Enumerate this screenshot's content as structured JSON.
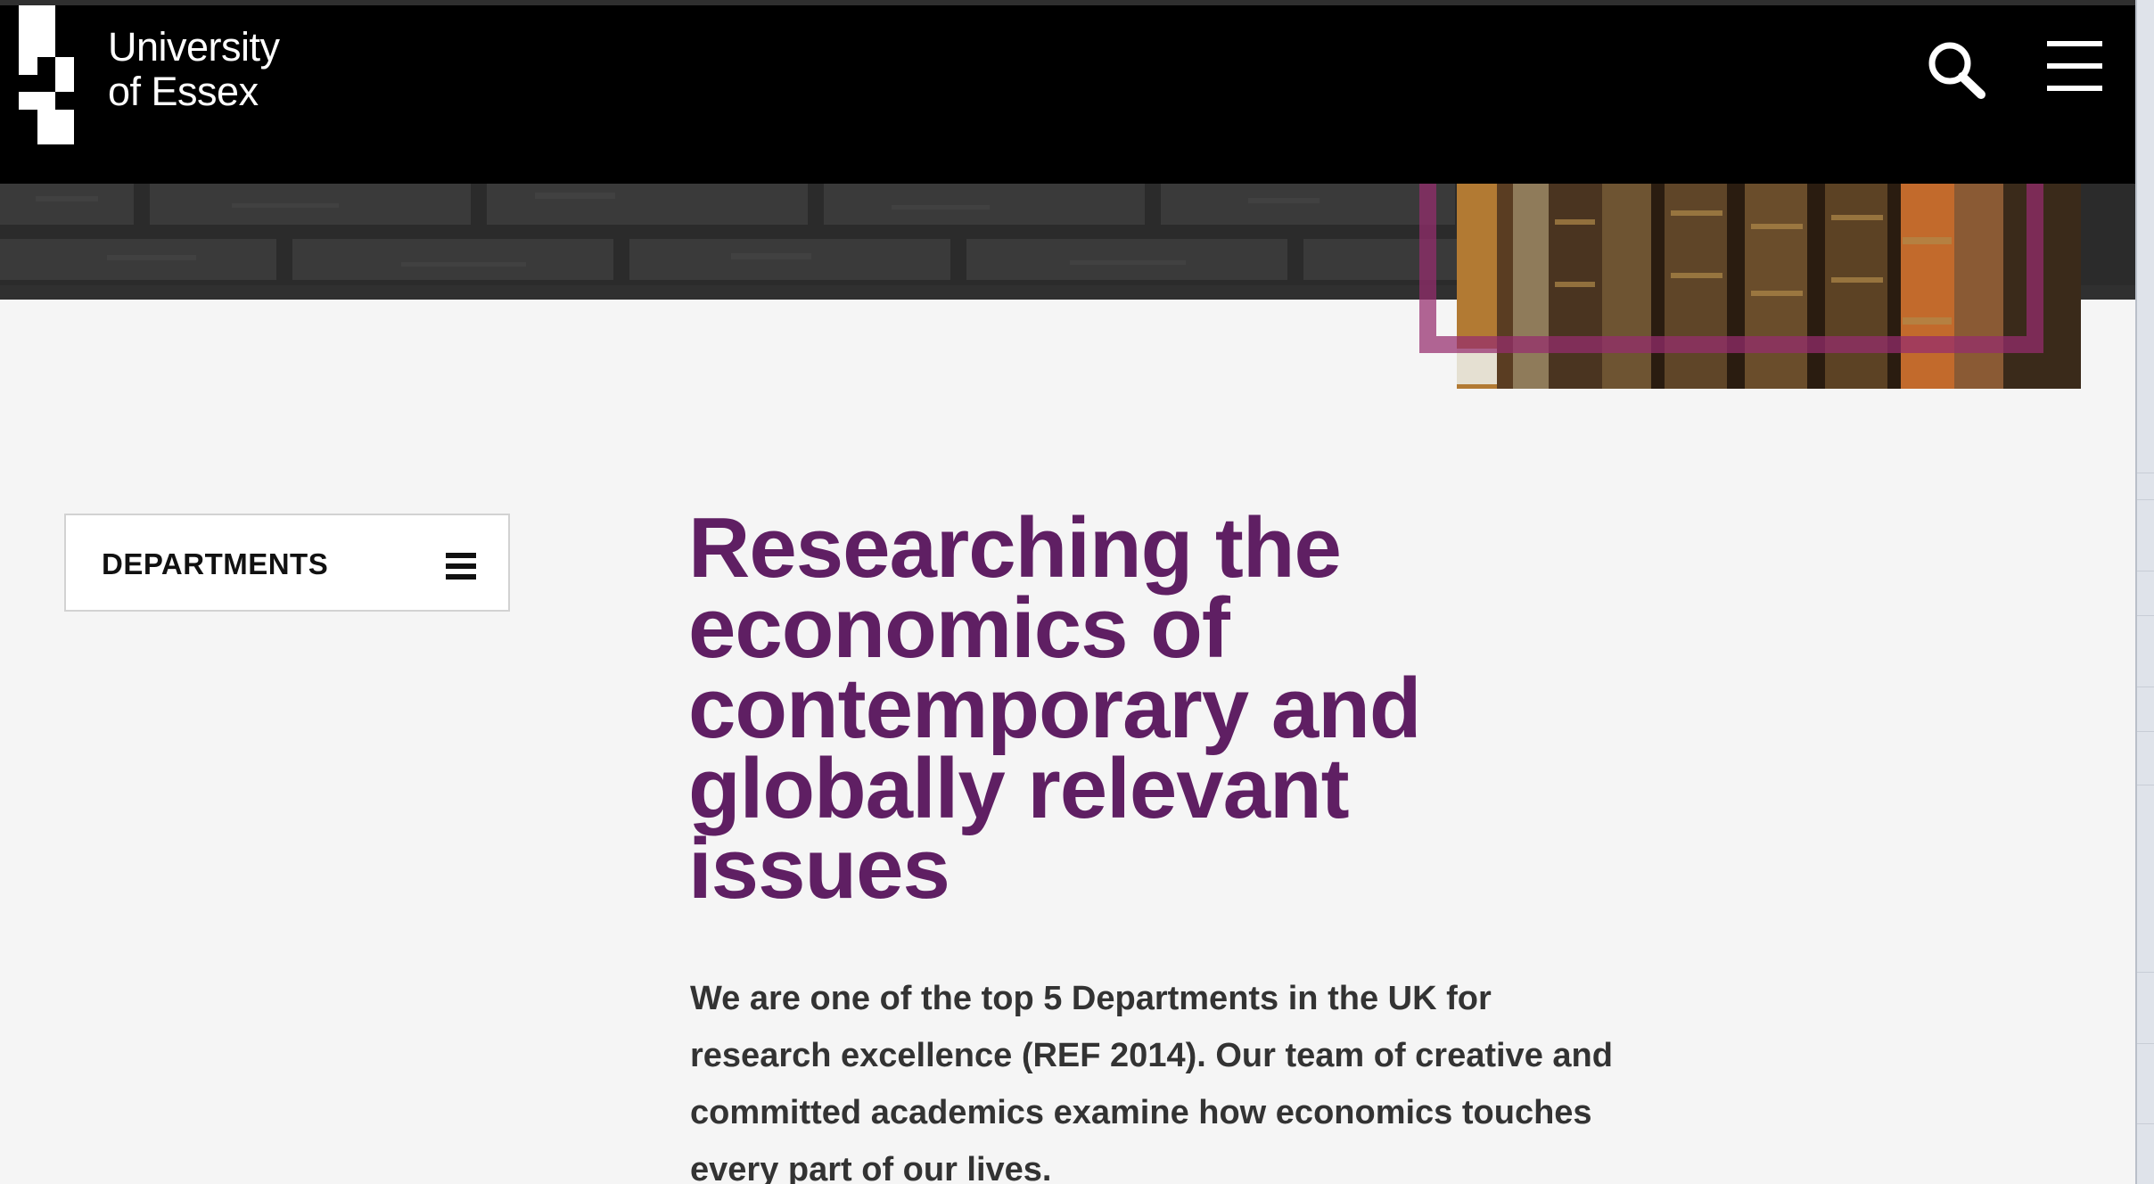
{
  "header": {
    "logo_text": "University\nof Essex",
    "search_icon": "search-icon",
    "menu_icon": "hamburger-menu-icon"
  },
  "hero": {
    "image": "bookshelf-photo"
  },
  "sidebar": {
    "departments_label": "DEPARTMENTS",
    "departments_icon": "list-icon"
  },
  "main": {
    "title": "Researching the economics of contemporary and globally relevant issues",
    "intro": "We are one of the top 5 Departments in the UK for research excellence (REF 2014). Our team of creative and committed academics examine how economics touches every part of our lives."
  },
  "colors": {
    "header_bg": "#000000",
    "title": "#5f1f63",
    "body_text": "#333333",
    "page_bg": "#f5f5f5",
    "frame_accent": "#962d6e"
  }
}
